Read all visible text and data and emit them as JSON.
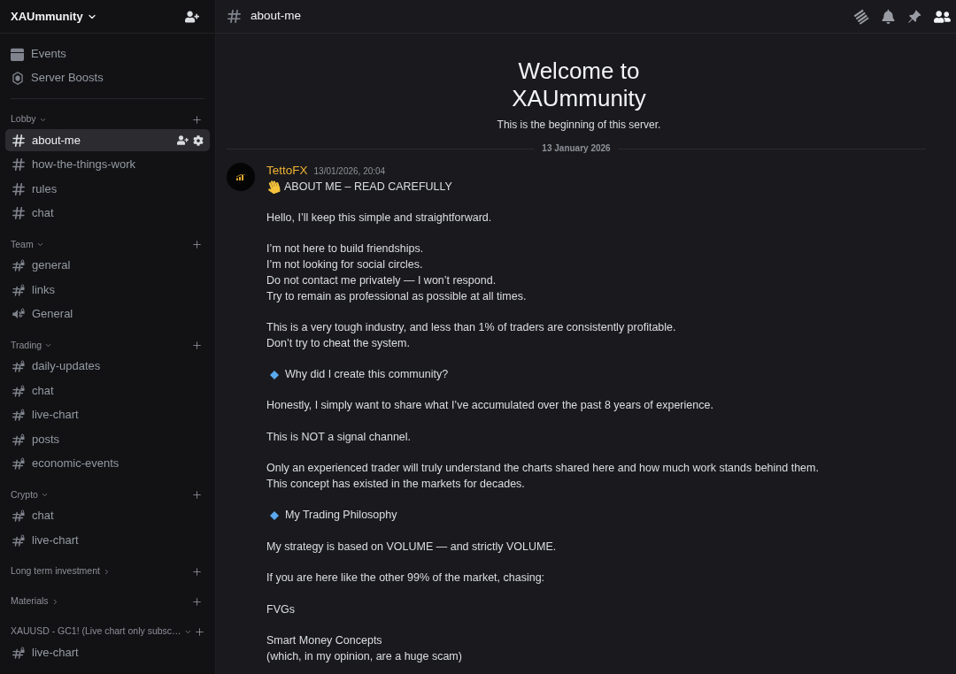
{
  "server": {
    "name": "XAUmmunity"
  },
  "sidebar": {
    "shortcuts": [
      {
        "kind": "events",
        "label": "Events"
      },
      {
        "kind": "boosts",
        "label": "Server Boosts"
      }
    ],
    "categories": [
      {
        "name": "Lobby",
        "expanded": true,
        "channels": [
          {
            "kind": "text",
            "name": "about-me",
            "selected": true
          },
          {
            "kind": "text",
            "name": "how-the-things-work",
            "selected": false
          },
          {
            "kind": "text",
            "name": "rules",
            "selected": false
          },
          {
            "kind": "text",
            "name": "chat",
            "selected": false
          }
        ]
      },
      {
        "name": "Team",
        "expanded": true,
        "channels": [
          {
            "kind": "locked_text",
            "name": "general",
            "selected": false
          },
          {
            "kind": "locked_text",
            "name": "links",
            "selected": false
          },
          {
            "kind": "locked_voice",
            "name": "General",
            "selected": false
          }
        ]
      },
      {
        "name": "Trading",
        "expanded": true,
        "channels": [
          {
            "kind": "locked_text",
            "name": "daily-updates",
            "selected": false
          },
          {
            "kind": "locked_text",
            "name": "chat",
            "selected": false
          },
          {
            "kind": "locked_text",
            "name": "live-chart",
            "selected": false
          },
          {
            "kind": "locked_text",
            "name": "posts",
            "selected": false
          },
          {
            "kind": "locked_text",
            "name": "economic-events",
            "selected": false
          }
        ]
      },
      {
        "name": "Crypto",
        "expanded": true,
        "channels": [
          {
            "kind": "locked_text",
            "name": "chat",
            "selected": false
          },
          {
            "kind": "locked_text",
            "name": "live-chart",
            "selected": false
          }
        ]
      },
      {
        "name": "Long term investment",
        "expanded": false
      },
      {
        "name": "Materials",
        "expanded": false
      },
      {
        "name": "XAUUSD - GC1! (Live chart only subsc…",
        "expanded": true,
        "channels": [
          {
            "kind": "locked_text",
            "name": "live-chart",
            "selected": false
          }
        ]
      }
    ]
  },
  "channel_header": {
    "name": "about-me",
    "tools": [
      {
        "kind": "threads",
        "selected": false
      },
      {
        "kind": "notifications",
        "selected": false
      },
      {
        "kind": "pins",
        "selected": false
      },
      {
        "kind": "members",
        "selected": true
      }
    ]
  },
  "welcome": {
    "title_lines": [
      "Welcome to",
      "XAUmmunity"
    ],
    "subtitle": "This is the beginning of this server."
  },
  "date_divider": "13 January 2026",
  "message": {
    "author": "TettoFX",
    "timestamp": "13/01/2026, 20:04",
    "paragraphs": [
      {
        "kind": "wave_heading",
        "lines": [
          "ABOUT ME – READ CAREFULLY"
        ]
      },
      {
        "kind": "text",
        "lines": [
          "Hello, I’ll keep this simple and straightforward."
        ]
      },
      {
        "kind": "text",
        "lines": [
          "I’m not here to build friendships.",
          "I’m not looking for social circles.",
          "Do not contact me privately — I won’t respond.",
          "Try to remain as professional as possible at all times."
        ]
      },
      {
        "kind": "text",
        "lines": [
          "This is a very tough industry, and less than 1% of traders are consistently profitable.",
          "Don’t try to cheat the system."
        ]
      },
      {
        "kind": "diamond_heading",
        "lines": [
          "Why did I create this community?"
        ]
      },
      {
        "kind": "text",
        "lines": [
          "Honestly, I simply want to share what I’ve accumulated over the past 8 years of experience."
        ]
      },
      {
        "kind": "text",
        "lines": [
          "This is NOT a signal channel."
        ]
      },
      {
        "kind": "text",
        "lines": [
          "Only an experienced trader will truly understand the charts shared here and how much work stands behind them.",
          "This concept has existed in the markets for decades."
        ]
      },
      {
        "kind": "diamond_heading",
        "lines": [
          "My Trading Philosophy"
        ]
      },
      {
        "kind": "text",
        "lines": [
          "My strategy is based on VOLUME — and strictly VOLUME."
        ]
      },
      {
        "kind": "text",
        "lines": [
          "If you are here like the other 99% of the market, chasing:"
        ]
      },
      {
        "kind": "text",
        "lines": [
          "FVGs"
        ]
      },
      {
        "kind": "text",
        "lines": [
          "Smart Money Concepts",
          "(which, in my opinion, are a huge scam)"
        ]
      }
    ]
  }
}
